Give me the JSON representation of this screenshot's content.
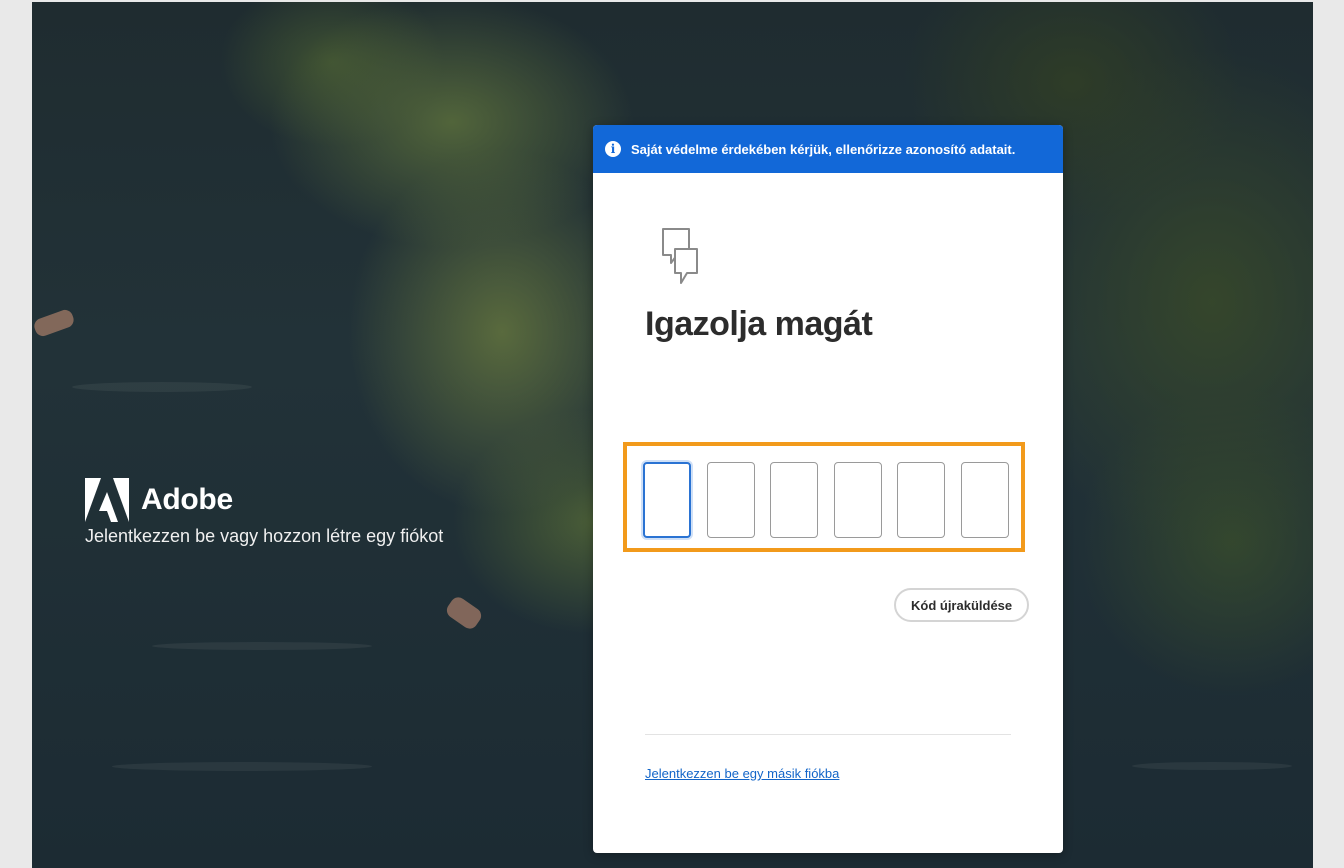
{
  "brand": {
    "name": "Adobe",
    "tagline": "Jelentkezzen be vagy hozzon létre egy fiókot",
    "logo_icon": "adobe-logo-icon"
  },
  "banner": {
    "icon": "info-icon",
    "icon_glyph": "i",
    "text": "Saját védelme érdekében kérjük, ellenőrizze azonosító adatait.",
    "color": "#1268d8"
  },
  "verify": {
    "icon": "chat-bubbles-icon",
    "heading": "Igazolja magát",
    "code_digits": [
      "",
      "",
      "",
      "",
      "",
      ""
    ],
    "highlight_color": "#f29a1b",
    "resend_label": "Kód újraküldése",
    "switch_account_link": "Jelentkezzen be egy másik fiókba"
  }
}
